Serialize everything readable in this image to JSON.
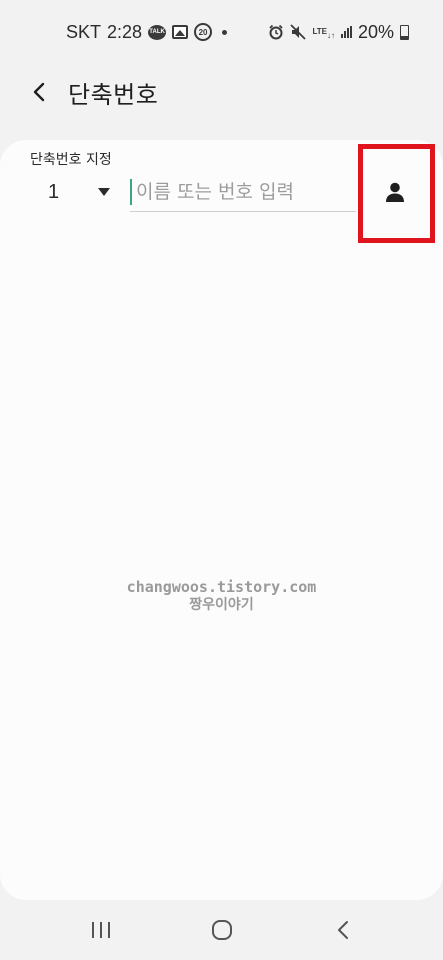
{
  "status_bar": {
    "carrier": "SKT",
    "time": "2:28",
    "chat_icon_text": "TALK",
    "speed_badge": "20",
    "network": "LTE",
    "battery": "20%"
  },
  "header": {
    "title": "단축번호"
  },
  "form": {
    "assign_label": "단축번호 지정",
    "number_value": "1",
    "name_placeholder": "이름 또는 번호 입력"
  },
  "watermark": {
    "line1": "changwoos.tistory.com",
    "line2": "짱우이야기"
  },
  "colors": {
    "accent_cursor": "#3aa57e",
    "highlight": "#e0141c"
  },
  "icons": {
    "back": "chevron-left-icon",
    "contact": "person-icon",
    "recents": "recents-icon",
    "home": "home-icon",
    "nav_back": "back-icon"
  }
}
